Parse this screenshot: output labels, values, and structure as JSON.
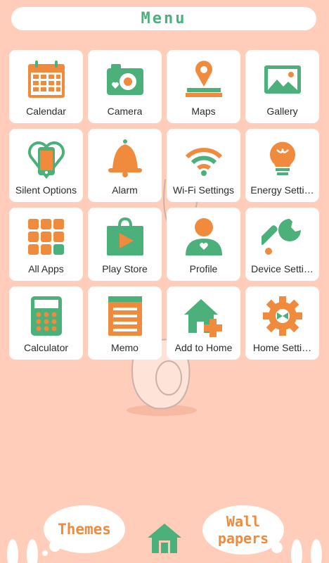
{
  "header": {
    "title": "Menu"
  },
  "colors": {
    "background": "#ffcdb9",
    "green": "#4bb07a",
    "orange": "#f08a3c",
    "tile": "#ffffff"
  },
  "tiles": [
    {
      "label": "Calendar",
      "icon": "calendar-icon"
    },
    {
      "label": "Camera",
      "icon": "camera-icon"
    },
    {
      "label": "Maps",
      "icon": "map-pin-icon"
    },
    {
      "label": "Gallery",
      "icon": "gallery-icon"
    },
    {
      "label": "Silent Options",
      "icon": "silent-phone-icon"
    },
    {
      "label": "Alarm",
      "icon": "bell-icon"
    },
    {
      "label": "Wi-Fi Settings",
      "icon": "wifi-icon"
    },
    {
      "label": "Energy Setti…",
      "icon": "lightbulb-icon"
    },
    {
      "label": "All Apps",
      "icon": "grid-icon"
    },
    {
      "label": "Play Store",
      "icon": "play-store-icon"
    },
    {
      "label": "Profile",
      "icon": "profile-icon"
    },
    {
      "label": "Device Setti…",
      "icon": "wrench-icon"
    },
    {
      "label": "Calculator",
      "icon": "calculator-icon"
    },
    {
      "label": "Memo",
      "icon": "memo-icon"
    },
    {
      "label": "Add to Home",
      "icon": "add-home-icon"
    },
    {
      "label": "Home Setti…",
      "icon": "gear-icon"
    }
  ],
  "bottom": {
    "themes_label": "Themes",
    "wall_label_1": "Wall",
    "wall_label_2": "papers",
    "home_icon": "home-icon"
  }
}
